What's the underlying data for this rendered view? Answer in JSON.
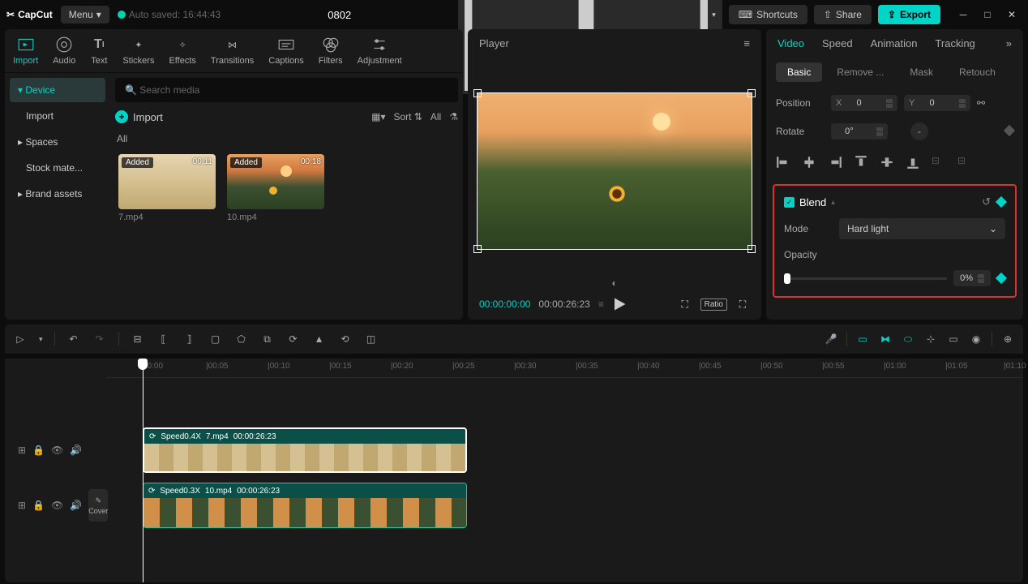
{
  "app": {
    "name": "CapCut",
    "menu": "Menu",
    "autosave": "Auto saved: 16:44:43",
    "title": "0802"
  },
  "topbar": {
    "shortcuts": "Shortcuts",
    "share": "Share",
    "export": "Export"
  },
  "tabs": {
    "import": "Import",
    "audio": "Audio",
    "text": "Text",
    "stickers": "Stickers",
    "effects": "Effects",
    "transitions": "Transitions",
    "captions": "Captions",
    "filters": "Filters",
    "adjustment": "Adjustment"
  },
  "sidebar": {
    "device": "Device",
    "import": "Import",
    "spaces": "Spaces",
    "stock": "Stock mate...",
    "brand": "Brand assets"
  },
  "media": {
    "search_ph": "Search media",
    "import_btn": "Import",
    "sort": "Sort",
    "all": "All",
    "all_header": "All",
    "items": [
      {
        "added": "Added",
        "dur": "00:11",
        "name": "7.mp4"
      },
      {
        "added": "Added",
        "dur": "00:18",
        "name": "10.mp4"
      }
    ]
  },
  "player": {
    "title": "Player",
    "cur": "00:00:00:00",
    "tot": "00:00:26:23",
    "ratio": "Ratio"
  },
  "props": {
    "tabs": {
      "video": "Video",
      "speed": "Speed",
      "animation": "Animation",
      "tracking": "Tracking"
    },
    "subtabs": {
      "basic": "Basic",
      "remove": "Remove ...",
      "mask": "Mask",
      "retouch": "Retouch"
    },
    "position": "Position",
    "x": "X",
    "xv": "0",
    "y": "Y",
    "yv": "0",
    "rotate": "Rotate",
    "rv": "0°",
    "dash": "-",
    "blend": {
      "title": "Blend",
      "mode_label": "Mode",
      "mode": "Hard light",
      "opacity_label": "Opacity",
      "opacity": "0%"
    }
  },
  "ruler": [
    "00:00",
    "|00:05",
    "|00:10",
    "|00:15",
    "|00:20",
    "|00:25",
    "|00:30",
    "|00:35",
    "|00:40",
    "|00:45",
    "|00:50",
    "|00:55",
    "|01:00",
    "|01:05",
    "|01:10"
  ],
  "clips": [
    {
      "speed": "Speed0.4X",
      "name": "7.mp4",
      "dur": "00:00:26:23"
    },
    {
      "speed": "Speed0.3X",
      "name": "10.mp4",
      "dur": "00:00:26:23"
    }
  ],
  "cover": "Cover"
}
